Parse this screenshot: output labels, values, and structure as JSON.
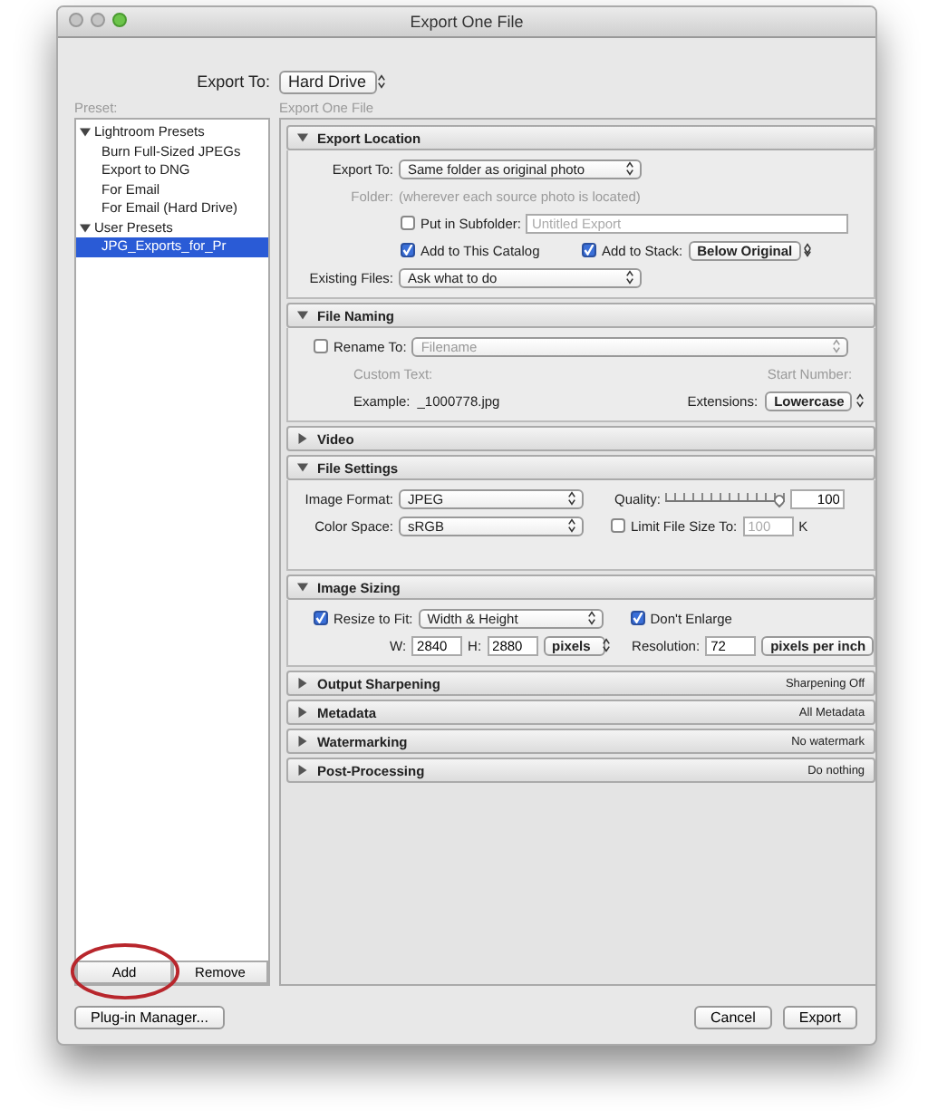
{
  "window": {
    "title": "Export One File"
  },
  "export_to": {
    "label": "Export To:",
    "value": "Hard Drive"
  },
  "preset_label": "Preset:",
  "presets": [
    {
      "label": "Lightroom Presets",
      "expanded": true,
      "selected": false,
      "children": [
        {
          "label": "Burn Full-Sized JPEGs",
          "selected": false
        },
        {
          "label": "Export to DNG",
          "selected": false
        },
        {
          "label": "For Email",
          "selected": false
        },
        {
          "label": "For Email (Hard Drive)",
          "selected": false
        }
      ]
    },
    {
      "label": "User Presets",
      "expanded": true,
      "selected": false,
      "children": [
        {
          "label": "JPG_Exports_for_Pr",
          "selected": true
        }
      ]
    }
  ],
  "preset_buttons": [
    "Add",
    "Remove"
  ],
  "panel_heading": "Export One File",
  "sections": [
    {
      "kind": "location",
      "title": "Export Location",
      "expanded": true,
      "export_to": {
        "label": "Export To:",
        "value": "Same folder as original photo"
      },
      "folder": {
        "label": "Folder:",
        "value": "(wherever each source photo is located)"
      },
      "subfolder": {
        "label": "Put in Subfolder:",
        "checked": false,
        "placeholder": "Untitled Export"
      },
      "catalog": {
        "label": "Add to This Catalog",
        "checked": true
      },
      "stack": {
        "label": "Add to Stack:",
        "checked": true,
        "value": "Below Original"
      },
      "existing": {
        "label": "Existing Files:",
        "value": "Ask what to do"
      }
    },
    {
      "kind": "naming",
      "title": "File Naming",
      "expanded": true,
      "rename": {
        "label": "Rename To:",
        "checked": false,
        "value": "Filename"
      },
      "custom_text": "Custom Text:",
      "start_number": "Start Number:",
      "example": {
        "label": "Example:",
        "value": "_1000778.jpg"
      },
      "extensions": {
        "label": "Extensions:",
        "value": "Lowercase"
      }
    },
    {
      "kind": "plain",
      "title": "Video",
      "expanded": false
    },
    {
      "kind": "settings",
      "title": "File Settings",
      "expanded": true,
      "format": {
        "label": "Image Format:",
        "value": "JPEG"
      },
      "color_space": {
        "label": "Color Space:",
        "value": "sRGB"
      },
      "quality": {
        "label": "Quality:",
        "level": 0.95,
        "value": "100"
      },
      "limit": {
        "label": "Limit File Size To:",
        "checked": false,
        "value": "100",
        "unit": "K"
      }
    },
    {
      "kind": "sizing",
      "title": "Image Sizing",
      "expanded": true,
      "resize": {
        "label": "Resize to Fit:",
        "checked": true,
        "value": "Width & Height"
      },
      "enlarge": {
        "label": "Don't Enlarge",
        "checked": true
      },
      "w": {
        "label": "W:",
        "value": "2840"
      },
      "h": {
        "label": "H:",
        "value": "2880"
      },
      "unit": "pixels",
      "resolution": {
        "label": "Resolution:",
        "value": "72"
      },
      "res_unit": "pixels per inch"
    },
    {
      "kind": "plain",
      "title": "Output Sharpening",
      "expanded": false,
      "summary": "Sharpening Off"
    },
    {
      "kind": "plain",
      "title": "Metadata",
      "expanded": false,
      "summary": "All Metadata"
    },
    {
      "kind": "plain",
      "title": "Watermarking",
      "expanded": false,
      "summary": "No watermark"
    },
    {
      "kind": "plain",
      "title": "Post-Processing",
      "expanded": false,
      "summary": "Do nothing"
    }
  ],
  "footer": {
    "plugin": "Plug-in Manager...",
    "cancel": "Cancel",
    "export": "Export"
  }
}
